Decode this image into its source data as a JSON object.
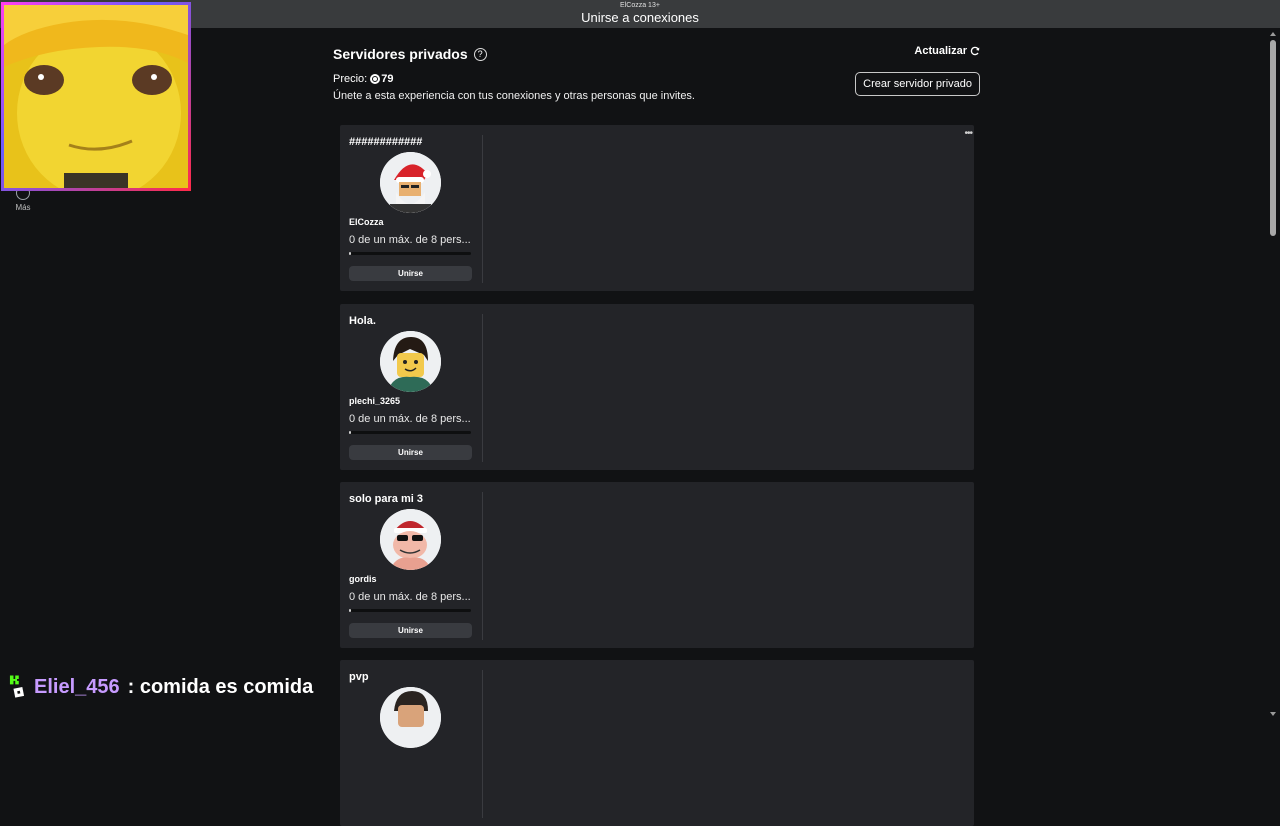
{
  "window": {
    "user_label": "ElCozza 13+",
    "title": "Unirse a conexiones"
  },
  "sidebar": {
    "more_label": "Más"
  },
  "header": {
    "title": "Servidores privados",
    "price_label": "Precio:",
    "price_value": "79",
    "description": "Únete a esta experiencia con tus conexiones y otras personas que invites.",
    "refresh_label": "Actualizar",
    "create_label": "Crear servidor privado"
  },
  "servers": [
    {
      "name": "############",
      "owner": "ElCozza",
      "count": "0 de un máx. de 8 pers...",
      "join": "Unirse",
      "fill": 0.0
    },
    {
      "name": "Hola.",
      "owner": "plechi_3265",
      "count": "0 de un máx. de 8 pers...",
      "join": "Unirse",
      "fill": 0.0
    },
    {
      "name": "solo para mi 3",
      "owner": "gordis",
      "count": "0 de un máx. de 8 pers...",
      "join": "Unirse",
      "fill": 0.0
    },
    {
      "name": "pvp"
    }
  ],
  "chat": {
    "username": "Eliel_456",
    "message": ": comida es comida"
  },
  "colors": {
    "background": "#111214",
    "card": "#232428",
    "topbar": "#393b3d",
    "chat_user": "#c79bff"
  }
}
